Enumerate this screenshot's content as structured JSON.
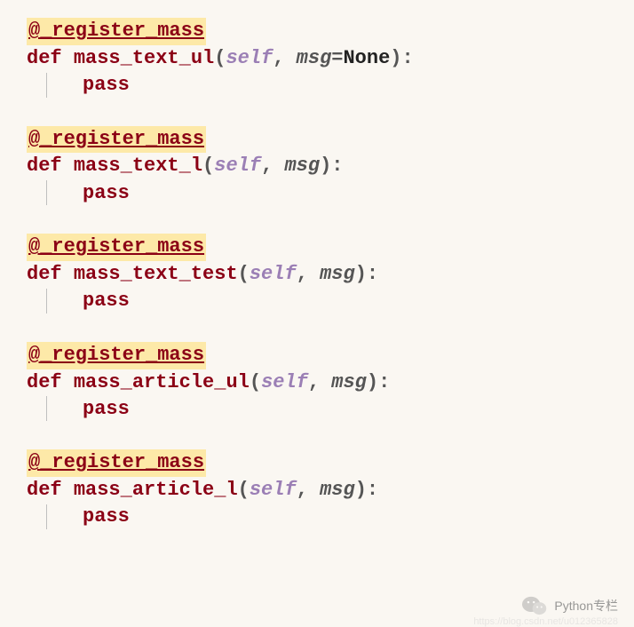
{
  "functions": [
    {
      "decorator": "@_register_mass",
      "def": "def",
      "name": "mass_text_ul",
      "open": "(",
      "self": "self",
      "comma": ", ",
      "param": "msg",
      "eq": "=",
      "default": "None",
      "close": ")",
      "colon": ":",
      "body": "pass"
    },
    {
      "decorator": "@_register_mass",
      "def": "def",
      "name": "mass_text_l",
      "open": "(",
      "self": "self",
      "comma": ", ",
      "param": "msg",
      "close": ")",
      "colon": ":",
      "body": "pass"
    },
    {
      "decorator": "@_register_mass",
      "def": "def",
      "name": "mass_text_test",
      "open": "(",
      "self": "self",
      "comma": ", ",
      "param": "msg",
      "close": ")",
      "colon": ":",
      "body": "pass"
    },
    {
      "decorator": "@_register_mass",
      "def": "def",
      "name": "mass_article_ul",
      "open": "(",
      "self": "self",
      "comma": ", ",
      "param": "msg",
      "close": ")",
      "colon": ":",
      "body": "pass"
    },
    {
      "decorator": "@_register_mass",
      "def": "def",
      "name": "mass_article_l",
      "open": "(",
      "self": "self",
      "comma": ", ",
      "param": "msg",
      "close": ")",
      "colon": ":",
      "body": "pass"
    }
  ],
  "watermark": {
    "text": "Python专栏",
    "sub": "https://blog.csdn.net/u012365828"
  }
}
